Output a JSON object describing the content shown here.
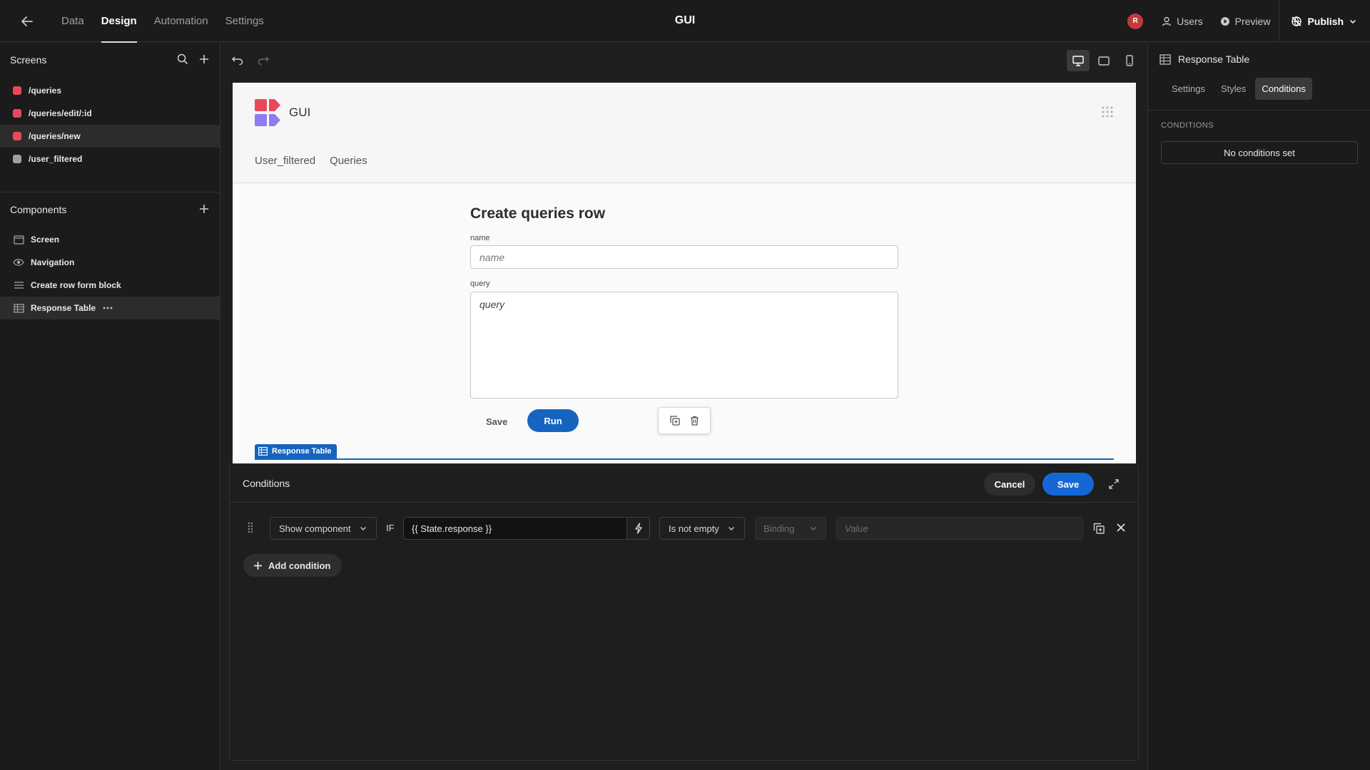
{
  "topbar": {
    "tabs": [
      "Data",
      "Design",
      "Automation",
      "Settings"
    ],
    "active_tab": "Design",
    "title": "GUI",
    "avatar_initial": "R",
    "users_label": "Users",
    "preview_label": "Preview",
    "publish_label": "Publish"
  },
  "screens": {
    "heading": "Screens",
    "items": [
      {
        "label": "/queries",
        "color": "#e8495a"
      },
      {
        "label": "/queries/edit/:id",
        "color": "#e8495a"
      },
      {
        "label": "/queries/new",
        "color": "#e8495a"
      },
      {
        "label": "/user_filtered",
        "color": "#a0a0a0"
      }
    ],
    "selected": "/queries/new"
  },
  "components": {
    "heading": "Components",
    "items": [
      {
        "label": "Screen",
        "icon": "screen-icon"
      },
      {
        "label": "Navigation",
        "icon": "eye-icon"
      },
      {
        "label": "Create row form block",
        "icon": "form-icon"
      },
      {
        "label": "Response Table",
        "icon": "table-icon"
      }
    ],
    "selected": "Response Table"
  },
  "preview": {
    "app_title": "GUI",
    "nav": [
      "User_filtered",
      "Queries"
    ],
    "form_title": "Create queries row",
    "name_label": "name",
    "name_placeholder": "name",
    "query_label": "query",
    "query_placeholder": "query",
    "save_label": "Save",
    "run_label": "Run",
    "selected_component_label": "Response Table"
  },
  "right_panel": {
    "component_name": "Response Table",
    "tabs": [
      "Settings",
      "Styles",
      "Conditions"
    ],
    "active_tab": "Conditions",
    "section_label": "CONDITIONS",
    "empty_text": "No conditions set"
  },
  "conditions_modal": {
    "title": "Conditions",
    "cancel_label": "Cancel",
    "save_label": "Save",
    "row": {
      "action": "Show component",
      "if_label": "IF",
      "binding_value": "{{ State.response }}",
      "operator": "Is not empty",
      "type_placeholder": "Binding",
      "value_placeholder": "Value"
    },
    "add_label": "Add condition"
  },
  "colors": {
    "accent": "#1567d6",
    "brand_red": "#e8495a",
    "brand_purple": "#8f7cf0"
  }
}
